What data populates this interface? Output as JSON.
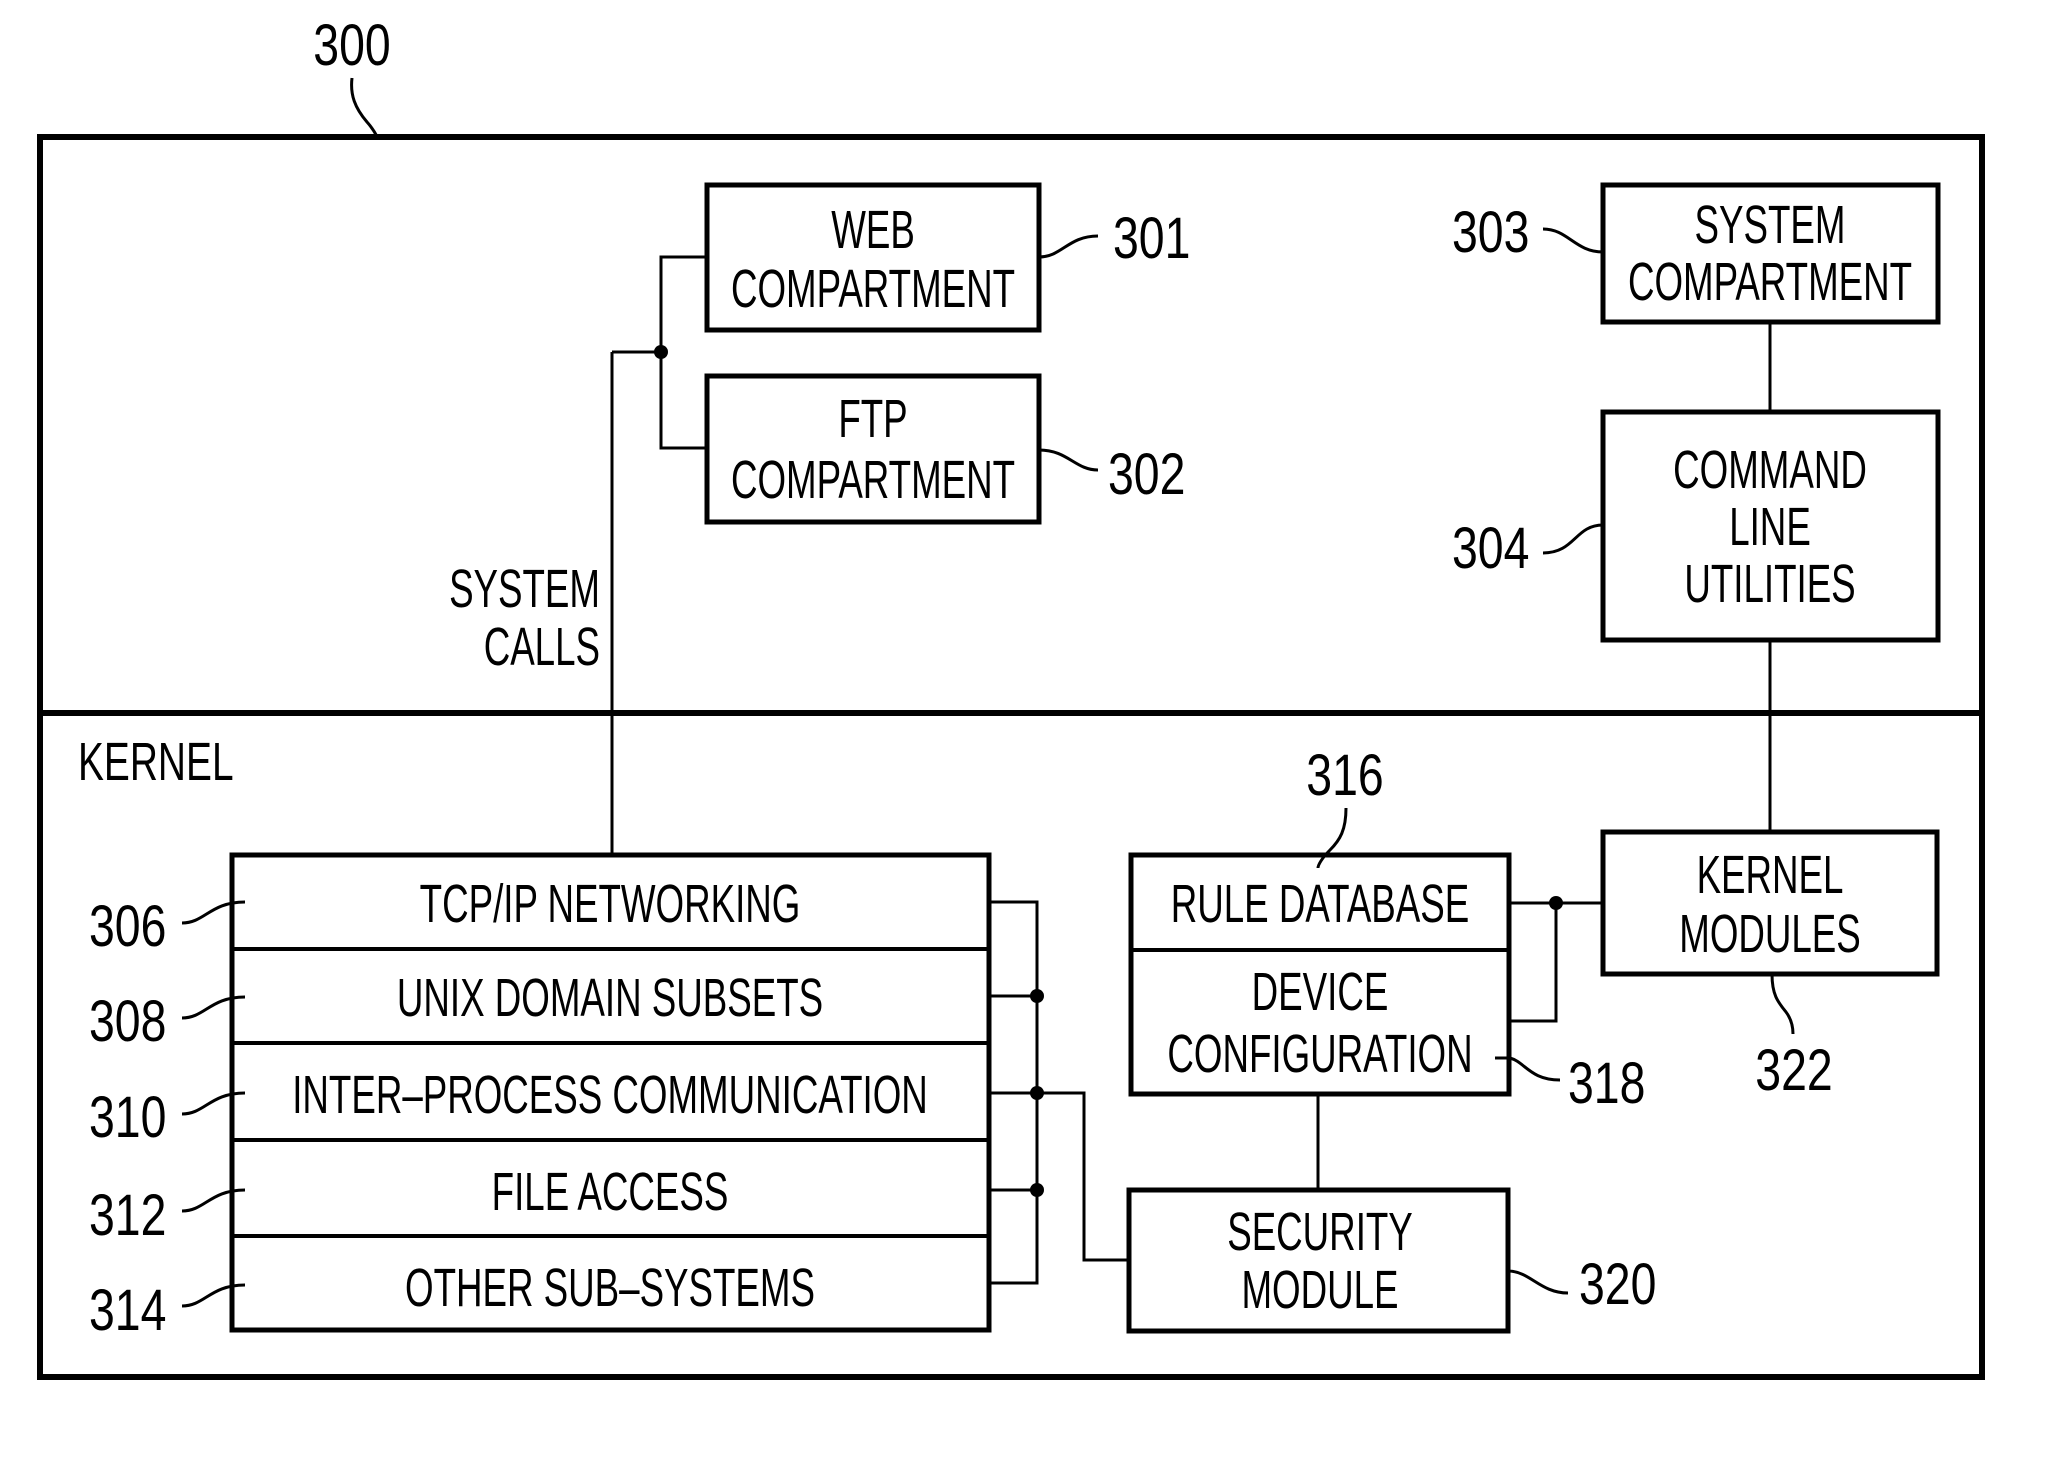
{
  "figure": {
    "ref": "300",
    "colors": {
      "line": "#000000",
      "background": "#ffffff"
    }
  },
  "user_space": {
    "system_calls_label": [
      "SYSTEM",
      "CALLS"
    ],
    "web_compartment": {
      "ref": "301",
      "lines": [
        "WEB",
        "COMPARTMENT"
      ]
    },
    "ftp_compartment": {
      "ref": "302",
      "lines": [
        "FTP",
        "COMPARTMENT"
      ]
    },
    "system_compartment": {
      "ref": "303",
      "lines": [
        "SYSTEM",
        "COMPARTMENT"
      ]
    },
    "command_line_utilities": {
      "ref": "304",
      "lines": [
        "COMMAND",
        "LINE",
        "UTILITIES"
      ]
    }
  },
  "kernel": {
    "label": "KERNEL",
    "subsystems": [
      {
        "ref": "306",
        "label": "TCP/IP  NETWORKING"
      },
      {
        "ref": "308",
        "label": "UNIX  DOMAIN  SUBSETS"
      },
      {
        "ref": "310",
        "label": "INTER–PROCESS  COMMUNICATION"
      },
      {
        "ref": "312",
        "label": "FILE  ACCESS"
      },
      {
        "ref": "314",
        "label": "OTHER  SUB–SYSTEMS"
      }
    ],
    "rule_database": {
      "ref": "316",
      "label": "RULE  DATABASE"
    },
    "device_configuration": {
      "ref": "318",
      "lines": [
        "DEVICE",
        "CONFIGURATION"
      ]
    },
    "security_module": {
      "ref": "320",
      "lines": [
        "SECURITY",
        "MODULE"
      ]
    },
    "kernel_modules": {
      "ref": "322",
      "lines": [
        "KERNEL",
        "MODULES"
      ]
    }
  }
}
